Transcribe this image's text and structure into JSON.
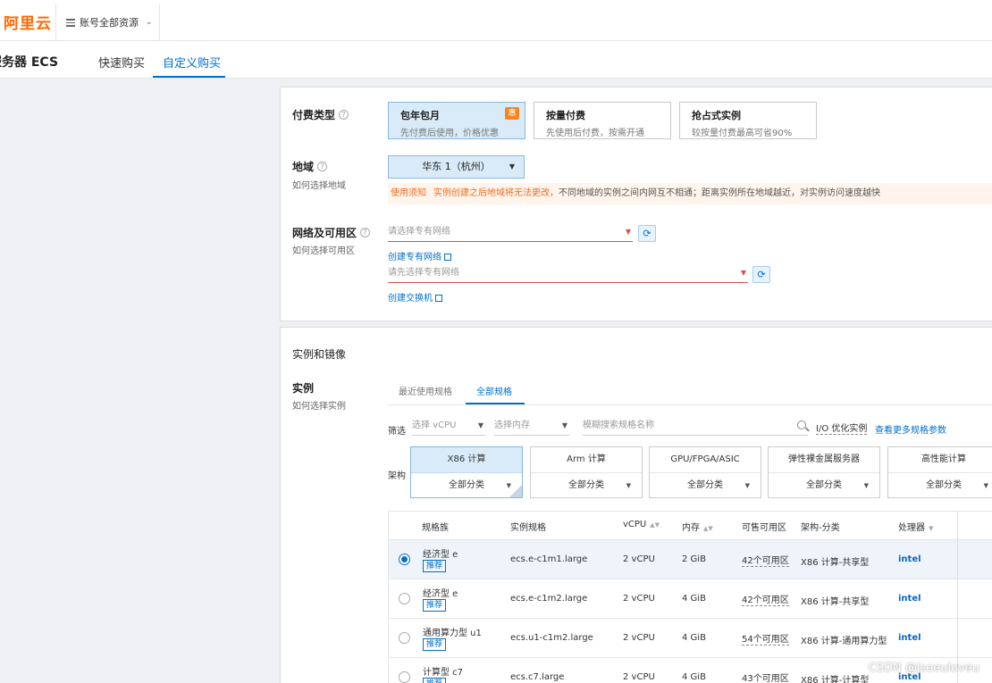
{
  "header": {
    "logo": "阿里云",
    "resource_label": "账号全部资源"
  },
  "subheader": {
    "product": "服务器 ECS",
    "tabs": [
      {
        "label": "快速购买",
        "active": false
      },
      {
        "label": "自定义购买",
        "active": true
      }
    ]
  },
  "billing": {
    "label": "付费类型",
    "options": [
      {
        "title": "包年包月",
        "desc": "先付费后使用，价格优惠",
        "selected": true,
        "badge": "惠"
      },
      {
        "title": "按量付费",
        "desc": "先使用后付费，按需开通",
        "selected": false
      },
      {
        "title": "抢占式实例",
        "desc": "较按量付费最高可省90%",
        "selected": false
      }
    ]
  },
  "region": {
    "label": "地域",
    "sublabel": "如何选择地域",
    "value": "华东 1（杭州）",
    "notice_tag": "使用须知",
    "notice_highlight": "实例创建之后地域将无法更改，",
    "notice_rest": "不同地域的实例之间内网互不相通；距离实例所在地域越近，对实例访问速度越快"
  },
  "network": {
    "label": "网络及可用区",
    "sublabel": "如何选择可用区",
    "vpc_placeholder": "请选择专有网络",
    "create_vpc": "创建专有网络",
    "vswitch_placeholder": "请先选择专有网络",
    "create_vswitch": "创建交换机"
  },
  "instance_section": {
    "title": "实例和镜像",
    "label": "实例",
    "sublabel": "如何选择实例",
    "tabs": [
      "最近使用规格",
      "全部规格"
    ],
    "filter_label": "筛选",
    "vcpu_placeholder": "选择 vCPU",
    "mem_placeholder": "选择内存",
    "search_placeholder": "模糊搜索规格名称",
    "io_label": "I/O 优化实例",
    "more_link": "查看更多规格参数",
    "arch_label": "架构",
    "archs": [
      {
        "name": "X86 计算",
        "cat": "全部分类",
        "selected": true
      },
      {
        "name": "Arm 计算",
        "cat": "全部分类",
        "selected": false
      },
      {
        "name": "GPU/FPGA/ASIC",
        "cat": "全部分类",
        "selected": false
      },
      {
        "name": "弹性裸金属服务器",
        "cat": "全部分类",
        "selected": false
      },
      {
        "name": "高性能计算",
        "cat": "全部分类",
        "selected": false
      }
    ]
  },
  "table": {
    "headers": [
      "规格族",
      "实例规格",
      "vCPU",
      "内存",
      "可售可用区",
      "架构-分类",
      "处理器"
    ],
    "recommend": "推荐",
    "rows": [
      {
        "family": "经济型 e",
        "spec": "ecs.e-c1m1.large",
        "vcpu": "2 vCPU",
        "mem": "2 GiB",
        "zones": "42个可用区",
        "arch": "X86 计算-共享型",
        "cpu": "intel",
        "selected": true
      },
      {
        "family": "经济型 e",
        "spec": "ecs.e-c1m2.large",
        "vcpu": "2 vCPU",
        "mem": "4 GiB",
        "zones": "42个可用区",
        "arch": "X86 计算-共享型",
        "cpu": "intel",
        "selected": false
      },
      {
        "family": "通用算力型 u1",
        "spec": "ecs.u1-c1m2.large",
        "vcpu": "2 vCPU",
        "mem": "4 GiB",
        "zones": "54个可用区",
        "arch": "X86 计算-通用算力型",
        "cpu": "intel",
        "selected": false
      },
      {
        "family": "计算型 c7",
        "spec": "ecs.c7.large",
        "vcpu": "2 vCPU",
        "mem": "4 GiB",
        "zones": "43个可用区",
        "arch": "X86 计算-计算型",
        "cpu": "intel",
        "selected": false
      }
    ]
  },
  "watermark": "CSDN @jseeuloveu"
}
